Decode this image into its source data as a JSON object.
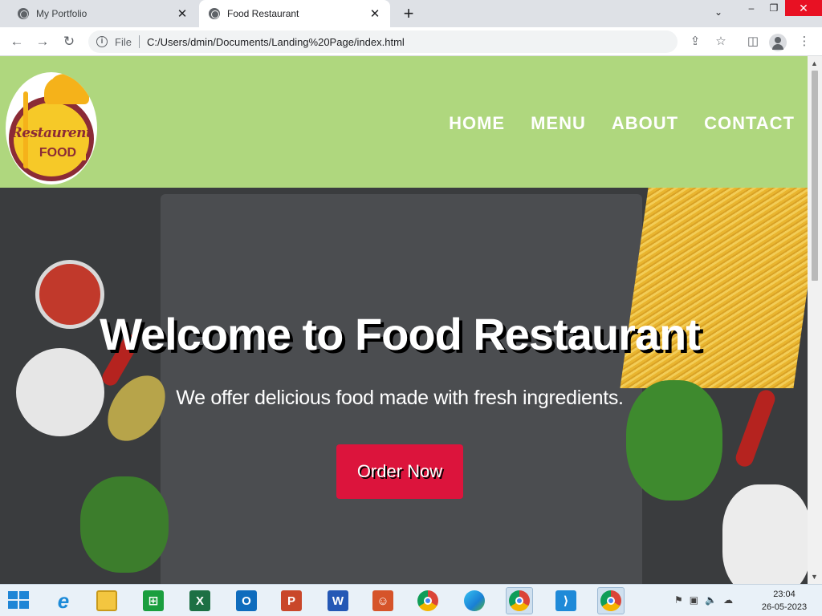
{
  "browser": {
    "tabs": [
      {
        "title": "My Portfolio",
        "active": false
      },
      {
        "title": "Food Restaurant",
        "active": true
      }
    ],
    "address": {
      "scheme_label": "File",
      "url": "C:/Users/dmin/Documents/Landing%20Page/index.html"
    }
  },
  "site": {
    "logo": {
      "line1": "Restaurent",
      "line2": "FOOD"
    },
    "nav": [
      "HOME",
      "MENU",
      "ABOUT",
      "CONTACT"
    ],
    "hero": {
      "title": "Welcome to Food Restaurant",
      "subtitle": "We offer delicious food made with fresh ingredients.",
      "cta": "Order Now"
    },
    "colors": {
      "header_bg": "#afd77e",
      "cta_bg": "#dc143c"
    }
  },
  "taskbar": {
    "apps": [
      "Internet Explorer",
      "File Explorer",
      "Store",
      "Excel",
      "Outlook",
      "PowerPoint",
      "Word",
      "People",
      "Chrome",
      "Edge",
      "Chrome (profile V)",
      "Visual Studio Code",
      "Chrome"
    ],
    "clock": {
      "time": "23:04",
      "date": "26-05-2023"
    }
  }
}
